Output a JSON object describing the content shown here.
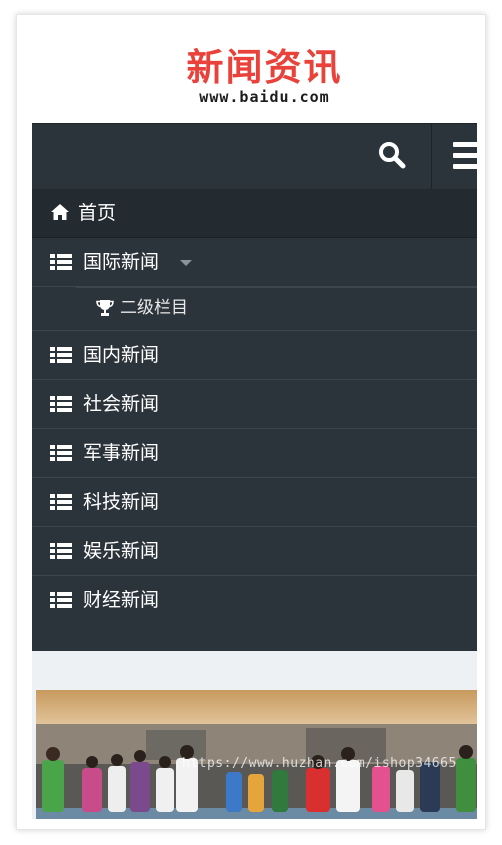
{
  "logo": {
    "title": "新闻资讯",
    "url": "www.baidu.com"
  },
  "toolbar": {
    "search_icon": "search-icon",
    "menu_icon": "hamburger-menu-icon"
  },
  "nav": {
    "home": {
      "label": "首页",
      "icon": "home-icon"
    },
    "items": [
      {
        "label": "国际新闻",
        "icon": "list-icon",
        "has_dropdown": true
      },
      {
        "label": "国内新闻",
        "icon": "list-icon"
      },
      {
        "label": "社会新闻",
        "icon": "list-icon"
      },
      {
        "label": "军事新闻",
        "icon": "list-icon"
      },
      {
        "label": "科技新闻",
        "icon": "list-icon"
      },
      {
        "label": "娱乐新闻",
        "icon": "list-icon"
      },
      {
        "label": "财经新闻",
        "icon": "list-icon"
      }
    ],
    "sub_item": {
      "label": "二级栏目",
      "icon": "trophy-icon"
    }
  },
  "photo": {
    "watermark": "https://www.huzhan.com/ishop34665"
  },
  "colors": {
    "brand_red": "#e8423a",
    "nav_bg": "#2c343b",
    "nav_active_bg": "#242b30"
  }
}
